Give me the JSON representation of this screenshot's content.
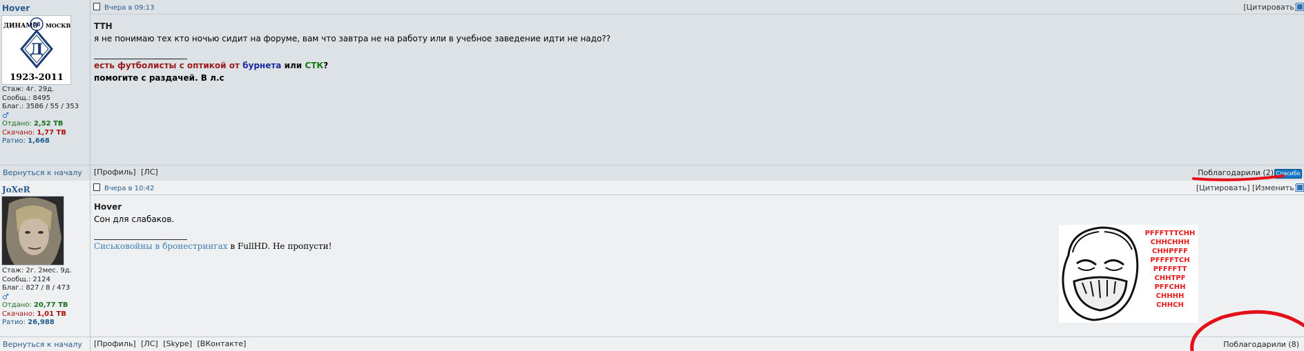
{
  "posts": [
    {
      "username": "Hover",
      "avatar_text_top": "ДИНАМО",
      "avatar_badge": "88",
      "avatar_text_right": "МОСКВА",
      "avatar_years": "1923-2011",
      "stats": {
        "stazh": "Стаж: 4г. 29д.",
        "soobsh": "Сообщ.: 8495",
        "blag": "Благ.: 3586 / 55 / 353",
        "otdano_label": "Отдано:",
        "otdano_value": "2,52 TB",
        "skachano_label": "Скачано:",
        "skachano_value": "1,77 TB",
        "ratio_label": "Ратио:",
        "ratio_value": "1,668"
      },
      "back_link": "Вернуться к началу",
      "date": "Вчера в 09:13",
      "tools": [
        "[Цитировать]"
      ],
      "quote_user": "TTH",
      "text": "я не понимаю тех кто ночью сидит на форуме, вам что завтра не на работу или в учебное заведение идти не надо??",
      "signature": {
        "part1": "есть футболисты с оптикой от",
        "part2": "бурнета",
        "part3": "или",
        "part4": "СТК",
        "part5": "?",
        "line2": "помогите с раздачей. В л.с"
      },
      "links": [
        "[Профиль]",
        "[ЛС]"
      ],
      "thanks": "Поблагодарили (2)",
      "thanks_button": "Спасибо"
    },
    {
      "username": "JoXeR",
      "stats": {
        "stazh": "Стаж: 2г. 2мес. 9д.",
        "soobsh": "Сообщ.: 2124",
        "blag": "Благ.: 827 / 8 / 473",
        "otdano_label": "Отдано:",
        "otdano_value": "20,77 TB",
        "skachano_label": "Скачано:",
        "skachano_value": "1,01 TB",
        "ratio_label": "Ратио:",
        "ratio_value": "26,988"
      },
      "back_link": "Вернуться к началу",
      "date": "Вчера в 10:42",
      "tools": [
        "[Цитировать]",
        "[Изменить]"
      ],
      "quote_user": "Hover",
      "text": "Сон для слабаков.",
      "signature": {
        "link": "Сиськовойны в бронестрингах",
        "rest": "в FullHD. Не пропусти!"
      },
      "meme_text": [
        "PFFFTTTCHH",
        "CHHCHHH",
        "CHHPFFF",
        "PFFFFTCH",
        "PFFFFTT",
        "CHHTPF",
        "PFFCHH",
        "CHHHH",
        "CHHCH"
      ],
      "links": [
        "[Профиль]",
        "[ЛС]",
        "[Skype]",
        "[ВКонтакте]"
      ],
      "thanks": "Поблагодарили (8)"
    }
  ],
  "colors": {
    "accent": "#2a5d8c",
    "annotation_red": "#e3101a"
  }
}
